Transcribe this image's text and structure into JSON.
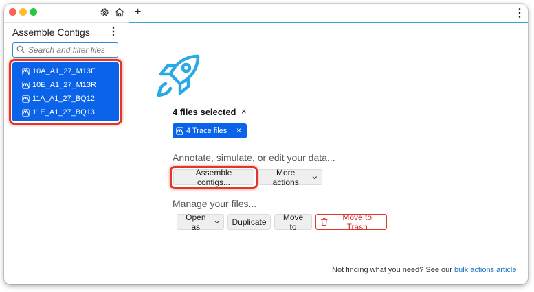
{
  "sidebar": {
    "title": "Assemble Contigs",
    "search_placeholder": "Search and filter files",
    "files": [
      "10A_A1_27_M13F",
      "10E_A1_27_M13R",
      "11A_A1_27_BQ12",
      "11E_A1_27_BQ13"
    ]
  },
  "main": {
    "new_tab_label": "+",
    "selected_title": "4 files selected",
    "clear_label": "×",
    "chip_label": "4 Trace files",
    "chip_remove": "×",
    "annotate_label": "Annotate, simulate, or edit your data...",
    "assemble_button": "Assemble contigs...",
    "more_actions_button": "More actions",
    "manage_label": "Manage your files...",
    "open_as_button": "Open as",
    "duplicate_button": "Duplicate",
    "move_to_button": "Move to",
    "trash_button": "Move to Trash",
    "footer_text": "Not finding what you need? See our ",
    "footer_link": "bulk actions article"
  },
  "colors": {
    "accent": "#0a63e8",
    "highlight": "#e0362c",
    "rocket": "#29a9e6",
    "divider": "#3aa0d8"
  }
}
